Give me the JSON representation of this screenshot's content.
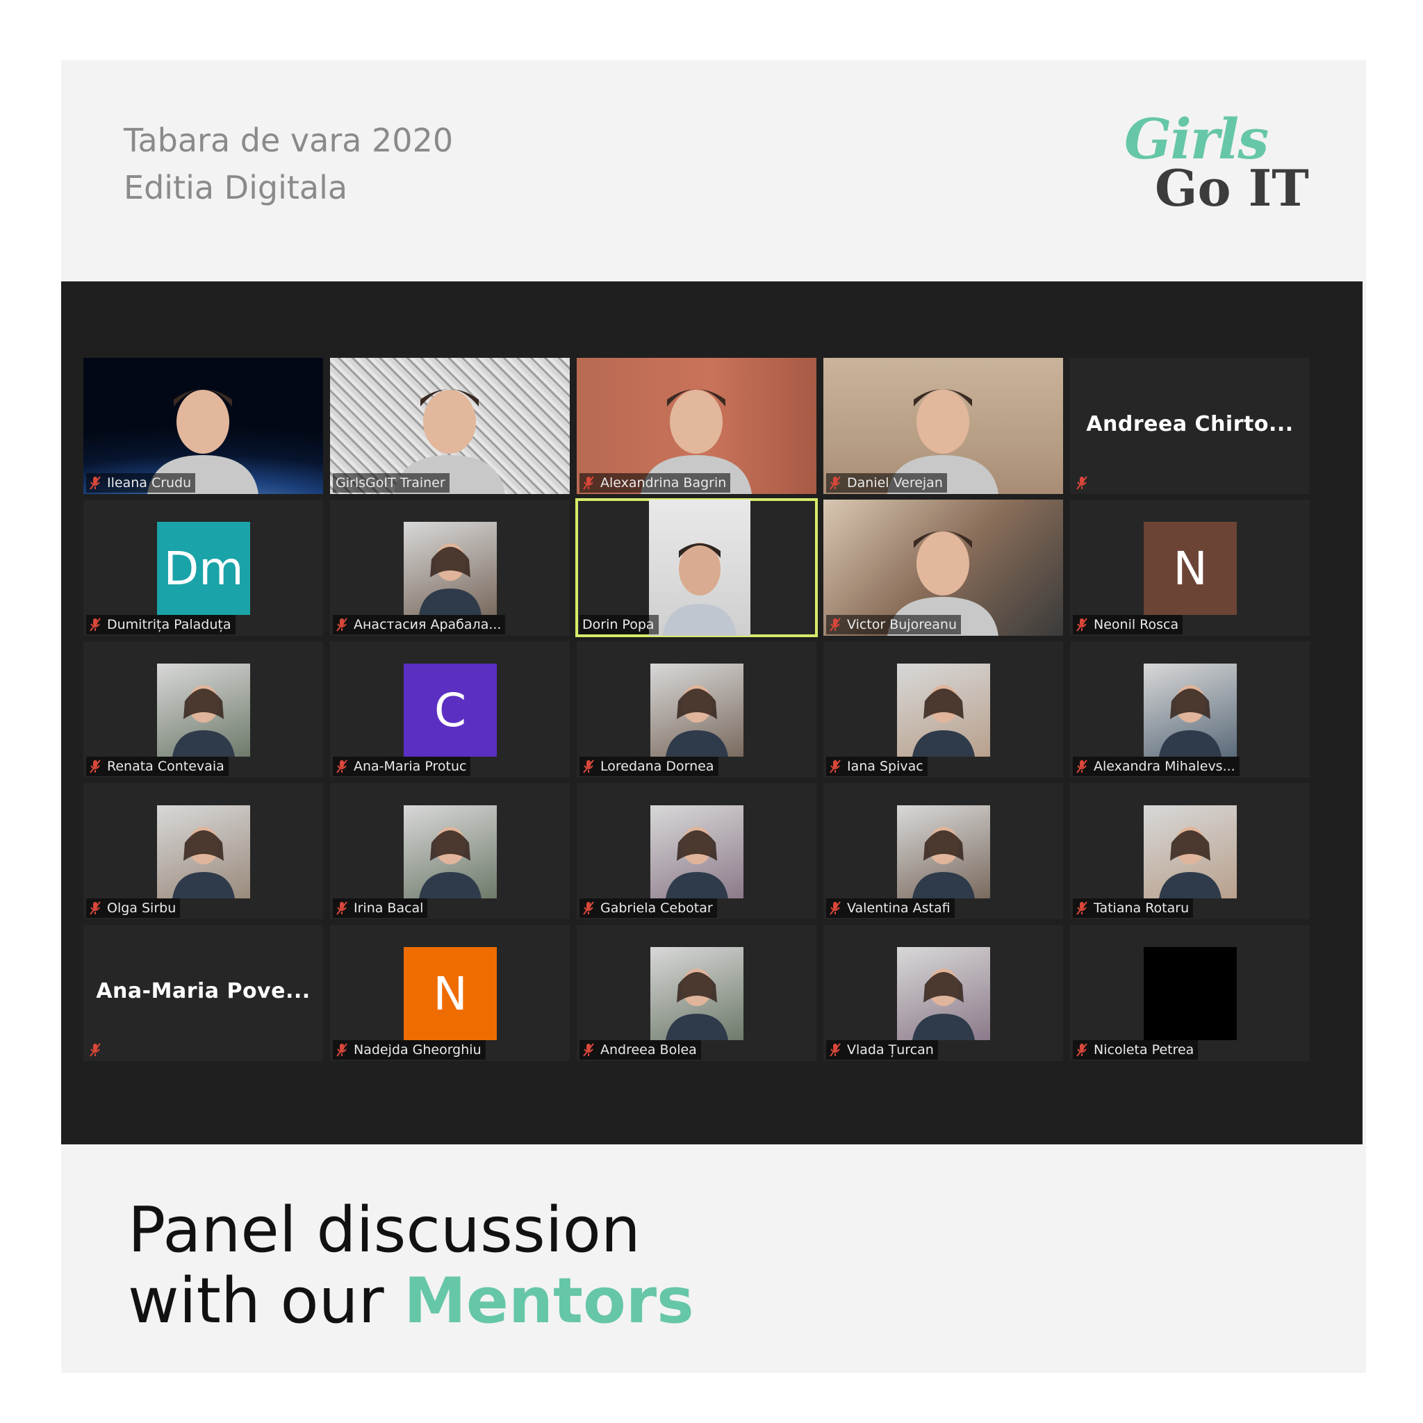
{
  "header": {
    "line1": "Tabara de vara 2020",
    "line2": "Editia Digitala"
  },
  "logo": {
    "girls": "Girls",
    "go_it": "Go IT"
  },
  "colors": {
    "brand_green": "#66c6a8",
    "screen_bg": "#1f1f1f",
    "active_border": "#d7ec6a",
    "mute_red": "#d9473a"
  },
  "participants": [
    {
      "name": "Ileana Crudu",
      "type": "video",
      "muted": true
    },
    {
      "name": "GirlsGoIT Trainer",
      "type": "video",
      "muted": false
    },
    {
      "name": "Alexandrina Bagrin",
      "type": "video",
      "muted": true
    },
    {
      "name": "Daniel Verejan",
      "type": "video",
      "muted": true
    },
    {
      "name": "Andreea Chirto...",
      "type": "name_only",
      "muted": true
    },
    {
      "name": "Dumitrița Paladuța",
      "type": "avatar",
      "avatar_text": "Dm",
      "avatar_color": "#1aa3a8",
      "muted": true
    },
    {
      "name": "Анастасия Арабала...",
      "type": "photo",
      "muted": true
    },
    {
      "name": "Dorin Popa",
      "type": "video_center",
      "muted": false,
      "active": true
    },
    {
      "name": "Victor Bujoreanu",
      "type": "video",
      "muted": true
    },
    {
      "name": "Neonil Rosca",
      "type": "avatar",
      "avatar_text": "N",
      "avatar_color": "#6b4436",
      "muted": true
    },
    {
      "name": "Renata Contevaia",
      "type": "photo",
      "muted": true
    },
    {
      "name": "Ana-Maria Protuc",
      "type": "avatar",
      "avatar_text": "C",
      "avatar_color": "#5a2fc2",
      "muted": true
    },
    {
      "name": "Loredana Dornea",
      "type": "photo",
      "muted": true
    },
    {
      "name": "Iana Spivac",
      "type": "photo",
      "muted": true
    },
    {
      "name": "Alexandra Mihalevs...",
      "type": "photo",
      "muted": true
    },
    {
      "name": "Olga Sirbu",
      "type": "photo",
      "muted": true
    },
    {
      "name": "Irina Bacal",
      "type": "photo",
      "muted": true
    },
    {
      "name": "Gabriela Cebotar",
      "type": "photo",
      "muted": true
    },
    {
      "name": "Valentina Astafi",
      "type": "photo",
      "muted": true
    },
    {
      "name": "Tatiana Rotaru",
      "type": "photo",
      "muted": true
    },
    {
      "name": "Ana-Maria Pove...",
      "type": "name_only",
      "muted": true
    },
    {
      "name": "Nadejda Gheorghiu",
      "type": "avatar",
      "avatar_text": "N",
      "avatar_color": "#ef6c00",
      "muted": true
    },
    {
      "name": "Andreea Bolea",
      "type": "photo",
      "muted": true
    },
    {
      "name": "Vlada Țurcan",
      "type": "photo",
      "muted": true
    },
    {
      "name": "Nicoleta Petrea",
      "type": "photo_black",
      "muted": true
    }
  ],
  "caption": {
    "line1": "Panel discussion",
    "line2_prefix": "with our ",
    "line2_accent": "Mentors"
  }
}
